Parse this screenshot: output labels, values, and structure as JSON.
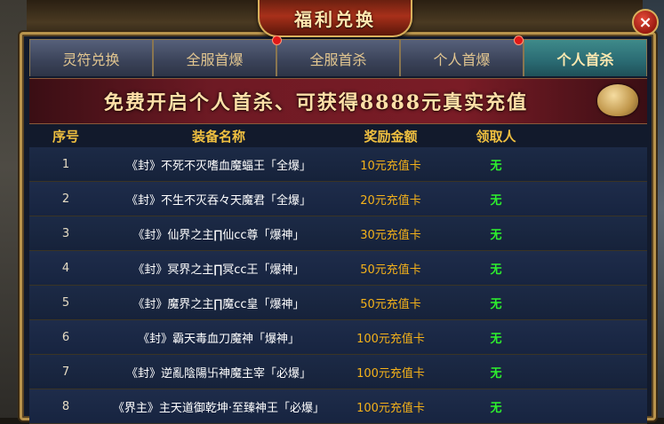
{
  "title": "福利兑换",
  "close_icon": "×",
  "tabs": [
    {
      "label": "灵符兑换",
      "active": false
    },
    {
      "label": "全服首爆",
      "active": false
    },
    {
      "label": "全服首杀",
      "active": false
    },
    {
      "label": "个人首爆",
      "active": false
    },
    {
      "label": "个人首杀",
      "active": true
    }
  ],
  "banner": "免费开启个人首杀、可获得8888元真实充值",
  "columns": [
    "序号",
    "装备名称",
    "奖励金额",
    "领取人"
  ],
  "rows": [
    {
      "no": "1",
      "name": "《封》不死不灭嗜血魔蝠王「全爆」",
      "reward": "10元充值卡",
      "receiver": "无"
    },
    {
      "no": "2",
      "name": "《封》不生不灭吞々天魔君「全爆」",
      "reward": "20元充值卡",
      "receiver": "无"
    },
    {
      "no": "3",
      "name": "《封》仙界之主∏仙cc尊「爆神」",
      "reward": "30元充值卡",
      "receiver": "无"
    },
    {
      "no": "4",
      "name": "《封》冥界之主∏冥cc王「爆神」",
      "reward": "50元充值卡",
      "receiver": "无"
    },
    {
      "no": "5",
      "name": "《封》魔界之主∏魔cc皇「爆神」",
      "reward": "50元充值卡",
      "receiver": "无"
    },
    {
      "no": "6",
      "name": "《封》霸天毒血刀魔神「爆神」",
      "reward": "100元充值卡",
      "receiver": "无"
    },
    {
      "no": "7",
      "name": "《封》逆亂陰陽卐神魔主宰「必爆」",
      "reward": "100元充值卡",
      "receiver": "无"
    },
    {
      "no": "8",
      "name": "《界主》主天道御乾坤·至臻神王「必爆」",
      "reward": "100元充值卡",
      "receiver": "无"
    }
  ],
  "colors": {
    "reward": "#f5b21a",
    "receiver": "#2ef02e",
    "header": "#f0c040",
    "active_tab": "#2a6a72"
  }
}
